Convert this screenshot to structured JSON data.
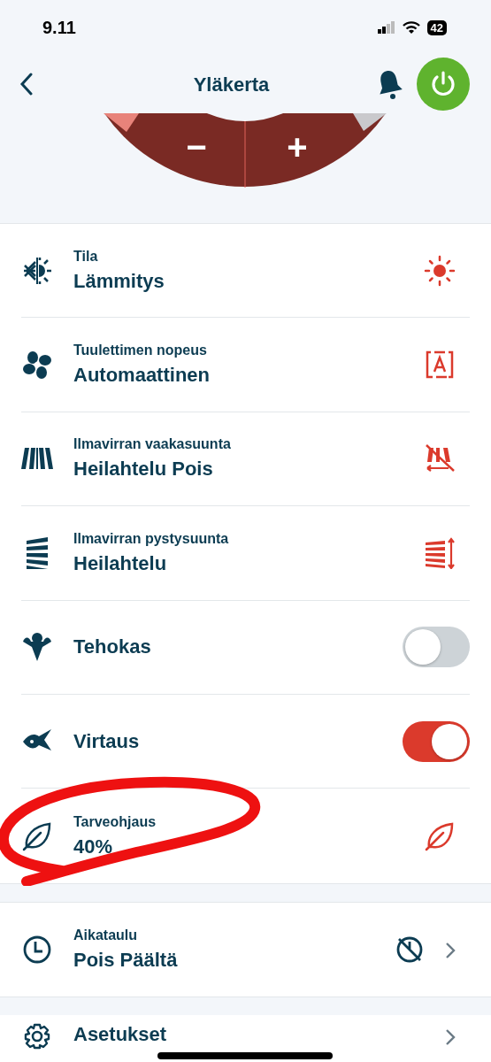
{
  "status_bar": {
    "time": "9.11",
    "battery": "42"
  },
  "header": {
    "title": "Yläkerta",
    "power_on": true
  },
  "dial": {
    "buttons": [
      "−",
      "+"
    ]
  },
  "settings": [
    {
      "kind": "select",
      "label": "Tila",
      "value": "Lämmitys"
    },
    {
      "kind": "select",
      "label": "Tuulettimen nopeus",
      "value": "Automaattinen"
    },
    {
      "kind": "select",
      "label": "Ilmavirran vaakasuunta",
      "value": "Heilahtelu Pois"
    },
    {
      "kind": "select",
      "label": "Ilmavirran pystysuunta",
      "value": "Heilahtelu"
    },
    {
      "kind": "toggle",
      "label": "Tehokas",
      "on": false
    },
    {
      "kind": "toggle",
      "label": "Virtaus",
      "on": true
    },
    {
      "kind": "select",
      "label": "Tarveohjaus",
      "value": "40%"
    }
  ],
  "schedule": {
    "label": "Aikataulu",
    "value": "Pois Päältä"
  },
  "menu": [
    {
      "label": "Asetukset"
    }
  ]
}
